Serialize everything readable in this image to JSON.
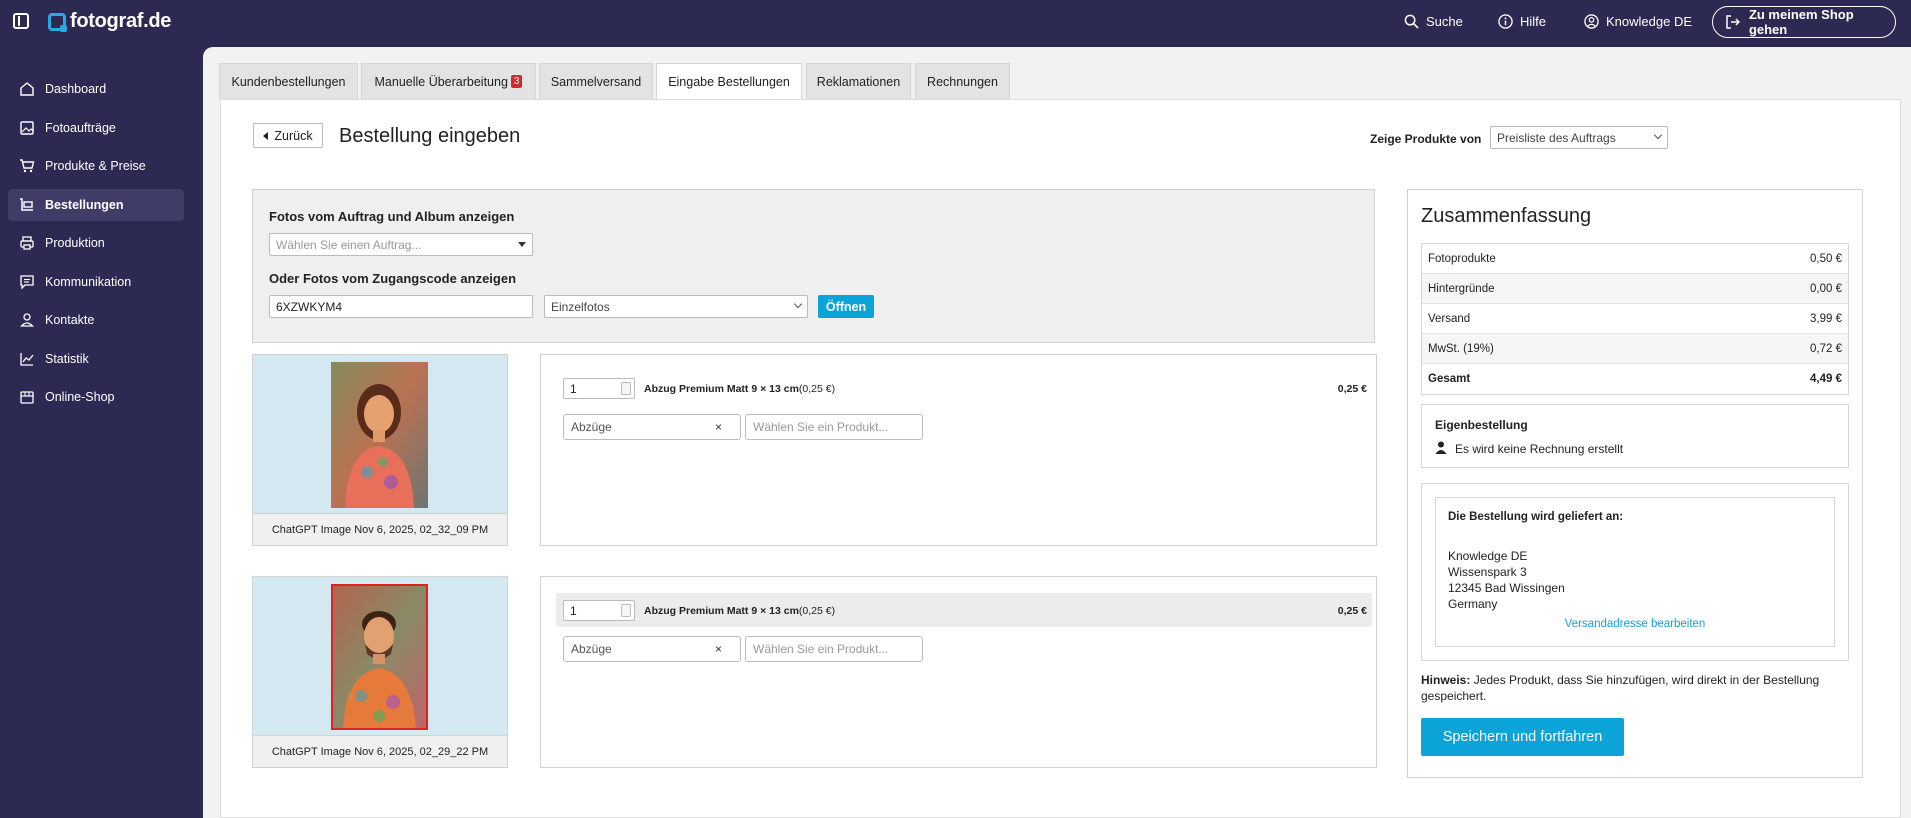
{
  "app": {
    "logo_text": "fotograf.de",
    "brand_color": "#2aa8e0",
    "sidebar_bg": "#2c2a52",
    "accent": "#0ba3d8"
  },
  "topbar": {
    "search_label": "Suche",
    "help_label": "Hilfe",
    "account_label": "Knowledge DE",
    "shop_button": "Zu meinem Shop gehen"
  },
  "sidebar": {
    "items": [
      {
        "label": "Dashboard",
        "icon": "home-icon"
      },
      {
        "label": "Fotoaufträge",
        "icon": "image-icon"
      },
      {
        "label": "Produkte & Preise",
        "icon": "cart-icon"
      },
      {
        "label": "Bestellungen",
        "icon": "basket-icon",
        "active": true
      },
      {
        "label": "Produktion",
        "icon": "printer-icon"
      },
      {
        "label": "Kommunikation",
        "icon": "chat-icon"
      },
      {
        "label": "Kontakte",
        "icon": "person-icon"
      },
      {
        "label": "Statistik",
        "icon": "chart-icon"
      },
      {
        "label": "Online-Shop",
        "icon": "store-icon"
      }
    ]
  },
  "tabs": [
    {
      "label": "Kundenbestellungen"
    },
    {
      "label": "Manuelle Überarbeitung",
      "badge": "3"
    },
    {
      "label": "Sammelversand"
    },
    {
      "label": "Eingabe Bestellungen",
      "active": true
    },
    {
      "label": "Reklamationen"
    },
    {
      "label": "Rechnungen"
    }
  ],
  "page": {
    "back_label": "Zurück",
    "title": "Bestellung eingeben",
    "show_products_label": "Zeige Produkte von",
    "show_products_value": "Preisliste des Auftrags"
  },
  "source": {
    "heading_album": "Fotos vom Auftrag und Album anzeigen",
    "order_placeholder": "Wählen Sie einen Auftrag...",
    "heading_code": "Oder Fotos vom Zugangscode anzeigen",
    "code_value": "6XZWKYM4",
    "type_value": "Einzelfotos",
    "open_button": "Öffnen"
  },
  "photos": [
    {
      "caption": "ChatGPT Image Nov 6, 2025, 02_32_09 PM",
      "qty": "1",
      "product": "Abzug Premium Matt 9 × 13 cm",
      "product_price": "(0,25 €)",
      "line_price": "0,25 €",
      "category": "Abzüge",
      "product_placeholder": "Wählen Sie ein Produkt..."
    },
    {
      "caption": "ChatGPT Image Nov 6, 2025, 02_29_22 PM",
      "qty": "1",
      "product": "Abzug Premium Matt 9 × 13 cm",
      "product_price": "(0,25 €)",
      "line_price": "0,25 €",
      "category": "Abzüge",
      "product_placeholder": "Wählen Sie ein Produkt..."
    }
  ],
  "summary": {
    "title": "Zusammenfassung",
    "rows": [
      {
        "label": "Fotoprodukte",
        "value": "0,50 €"
      },
      {
        "label": "Hintergründe",
        "value": "0,00 €"
      },
      {
        "label": "Versand",
        "value": "3,99 €"
      },
      {
        "label": "MwSt. (19%)",
        "value": "0,72 €"
      },
      {
        "label": "Gesamt",
        "value": "4,49 €"
      }
    ],
    "own_order_title": "Eigenbestellung",
    "own_order_note": "Es wird keine Rechnung erstellt",
    "delivery_title": "Die Bestellung wird geliefert an:",
    "address": [
      "Knowledge DE",
      "Wissenspark 3",
      "12345 Bad Wissingen",
      "Germany"
    ],
    "edit_address": "Versandadresse bearbeiten",
    "hint_label": "Hinweis:",
    "hint_text": "Jedes Produkt, dass Sie hinzufügen, wird direkt in der Bestellung gespeichert.",
    "save_button": "Speichern und fortfahren"
  }
}
